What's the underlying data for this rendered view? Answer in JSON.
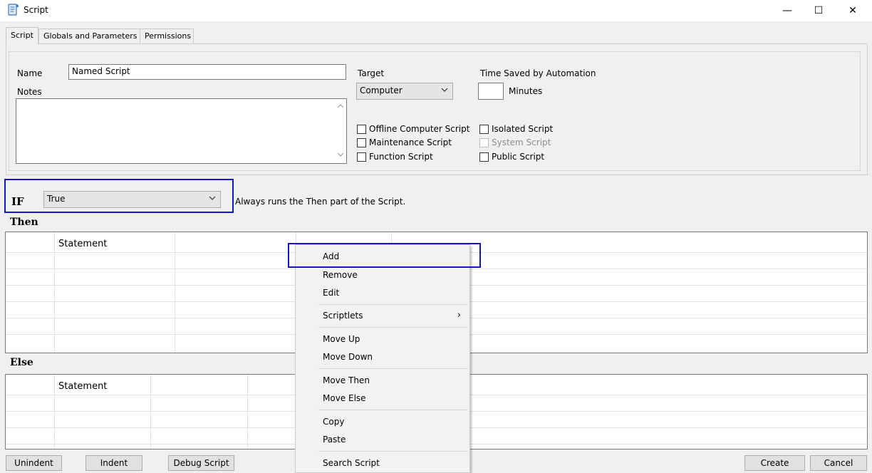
{
  "window": {
    "title": "Script",
    "minimize_glyph": "—",
    "maximize_glyph": "☐",
    "close_glyph": "✕"
  },
  "tabs": [
    {
      "label": "Script"
    },
    {
      "label": "Globals and Parameters"
    },
    {
      "label": "Permissions"
    }
  ],
  "form": {
    "name_label": "Name",
    "name_value": "Named Script",
    "notes_label": "Notes",
    "notes_value": "",
    "target_label": "Target",
    "target_value": "Computer",
    "time_saved_label": "Time Saved by Automation",
    "minutes_value": "",
    "minutes_label": "Minutes",
    "checkboxes": [
      {
        "label": "Offline Computer Script",
        "checked": false,
        "enabled": true
      },
      {
        "label": "Maintenance Script",
        "checked": false,
        "enabled": true
      },
      {
        "label": "Function Script",
        "checked": false,
        "enabled": true
      },
      {
        "label": "Isolated Script",
        "checked": false,
        "enabled": true
      },
      {
        "label": "System Script",
        "checked": false,
        "enabled": false
      },
      {
        "label": "Public Script",
        "checked": false,
        "enabled": true
      }
    ]
  },
  "condition": {
    "if_label": "IF",
    "if_value": "True",
    "if_description": "Always runs the Then part of the Script."
  },
  "then_section": {
    "heading": "Then",
    "column_header": "Statement"
  },
  "else_section": {
    "heading": "Else",
    "column_header": "Statement"
  },
  "context_menu": {
    "items": [
      {
        "label": "Add"
      },
      {
        "label": "Remove"
      },
      {
        "label": "Edit"
      },
      {
        "label": "Scriptlets",
        "submenu_arrow": "›"
      },
      {
        "label": "Move Up"
      },
      {
        "label": "Move Down"
      },
      {
        "label": "Move Then"
      },
      {
        "label": "Move Else"
      },
      {
        "label": "Copy"
      },
      {
        "label": "Paste"
      },
      {
        "label": "Search Script"
      }
    ]
  },
  "footer": {
    "unindent_label": "Unindent",
    "indent_label": "Indent",
    "debug_label": "Debug Script",
    "create_label": "Create",
    "cancel_label": "Cancel"
  },
  "highlight_color": "#1414c8"
}
